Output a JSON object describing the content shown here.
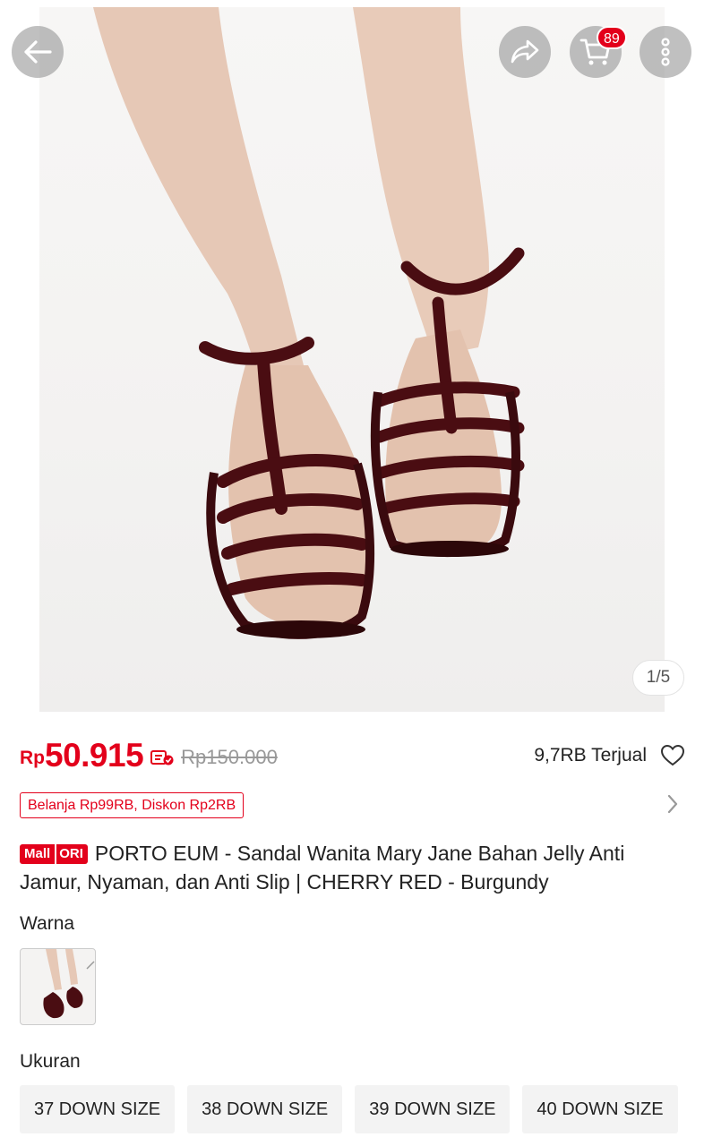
{
  "gallery": {
    "counter": "1/5",
    "cart_badge": "89",
    "icons": [
      "back-arrow-icon",
      "share-icon",
      "cart-icon",
      "more-vertical-icon"
    ]
  },
  "price": {
    "currency": "Rp",
    "value": "50.915",
    "original": "Rp150.000",
    "sold": "9,7RB Terjual"
  },
  "voucher": {
    "label": "Belanja Rp99RB, Diskon Rp2RB"
  },
  "product": {
    "badge_mall": "Mall",
    "badge_ori": "ORI",
    "title": "PORTO EUM - Sandal Wanita Mary Jane Bahan Jelly Anti Jamur, Nyaman, dan Anti Slip | CHERRY RED - Burgundy"
  },
  "variants": {
    "color_label": "Warna",
    "size_label": "Ukuran",
    "sizes": [
      "37 DOWN SIZE",
      "38 DOWN SIZE",
      "39 DOWN SIZE",
      "40 DOWN SIZE"
    ]
  },
  "colors": {
    "accent": "#e3001b",
    "sandal": "#4a0d12"
  }
}
